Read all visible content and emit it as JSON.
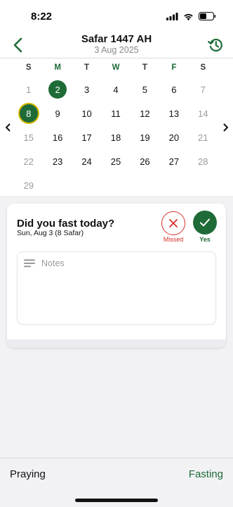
{
  "status_bar": {
    "time": "8:22"
  },
  "header": {
    "title": "Safar 1447 AH",
    "subtitle": "3 Aug 2025"
  },
  "weekdays": [
    "S",
    "M",
    "T",
    "W",
    "T",
    "F",
    "S"
  ],
  "calendar": {
    "rows": [
      [
        {
          "d": "1",
          "m": true
        },
        {
          "d": "2",
          "sel": true
        },
        {
          "d": "3"
        },
        {
          "d": "4"
        },
        {
          "d": "5"
        },
        {
          "d": "6"
        },
        {
          "d": "7",
          "m": true
        }
      ],
      [
        {
          "d": "8",
          "today": true
        },
        {
          "d": "9"
        },
        {
          "d": "10"
        },
        {
          "d": "11"
        },
        {
          "d": "12"
        },
        {
          "d": "13"
        },
        {
          "d": "14",
          "m": true
        }
      ],
      [
        {
          "d": "15",
          "m": true
        },
        {
          "d": "16"
        },
        {
          "d": "17"
        },
        {
          "d": "18"
        },
        {
          "d": "19"
        },
        {
          "d": "20"
        },
        {
          "d": "21",
          "m": true
        }
      ],
      [
        {
          "d": "22",
          "m": true
        },
        {
          "d": "23"
        },
        {
          "d": "24"
        },
        {
          "d": "25"
        },
        {
          "d": "26"
        },
        {
          "d": "27"
        },
        {
          "d": "28",
          "m": true
        }
      ],
      [
        {
          "d": "29",
          "m": true
        }
      ]
    ]
  },
  "card": {
    "question": "Did you fast today?",
    "date": "Sun, Aug 3 (8 Safar)",
    "missed_label": "Missed",
    "yes_label": "Yes",
    "notes_placeholder": "Notes"
  },
  "tabs": {
    "praying": "Praying",
    "fasting": "Fasting"
  },
  "colors": {
    "accent": "#1e6b37",
    "missed": "#d7302a",
    "today_ring": "#d9b800"
  },
  "icons": [
    "back-chevron-icon",
    "history-icon",
    "close-icon",
    "checkmark-icon",
    "notes-lines-icon",
    "chevron-left-icon",
    "chevron-right-icon"
  ]
}
